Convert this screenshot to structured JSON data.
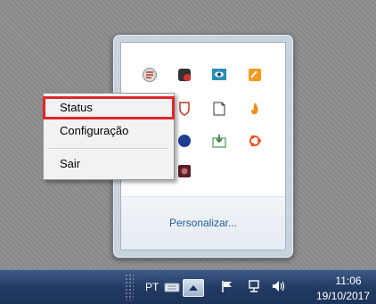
{
  "context_menu": {
    "items": [
      {
        "label": "Status",
        "highlighted": true
      },
      {
        "label": "Configuração",
        "highlighted": false
      },
      {
        "label": "Sair",
        "highlighted": false
      }
    ]
  },
  "tray_popup": {
    "customize_label": "Personalizar...",
    "icons": [
      "shield-badge-icon",
      "antivirus-icon",
      "eye-monitor-icon",
      "sticky-note-icon",
      "flag-shield-icon",
      "document-icon",
      "flame-icon",
      "globe-icon",
      "inbox-arrow-icon",
      "ubuntu-icon",
      "app-icon"
    ]
  },
  "taskbar": {
    "language": "PT",
    "time": "11:06",
    "date": "19/10/2017"
  },
  "colors": {
    "highlight_outline": "#e0262b",
    "link": "#1f5b9c",
    "taskbar": "#233c64"
  }
}
